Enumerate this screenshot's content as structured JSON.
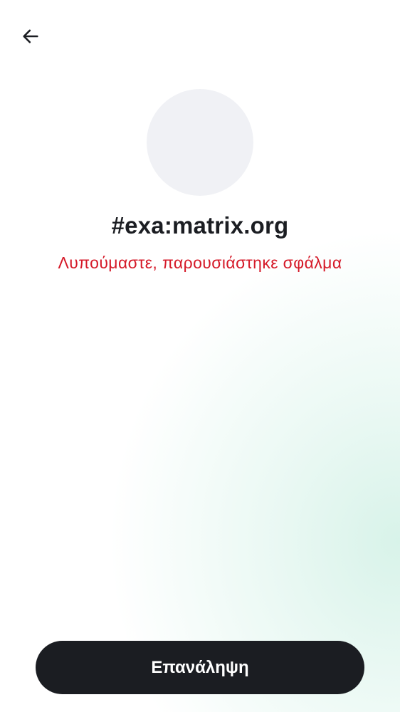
{
  "header": {
    "back_icon": "arrow-left-icon"
  },
  "room": {
    "title": "#exa:matrix.org",
    "error": "Λυπούμαστε, παρουσιάστηκε σφάλμα"
  },
  "actions": {
    "retry_label": "Επανάληψη"
  },
  "colors": {
    "text_primary": "#1b1d22",
    "error": "#d51928",
    "button_bg": "#1b1d22",
    "avatar_bg": "#f0f1f5",
    "gradient_tint": "#d6f2e8"
  }
}
